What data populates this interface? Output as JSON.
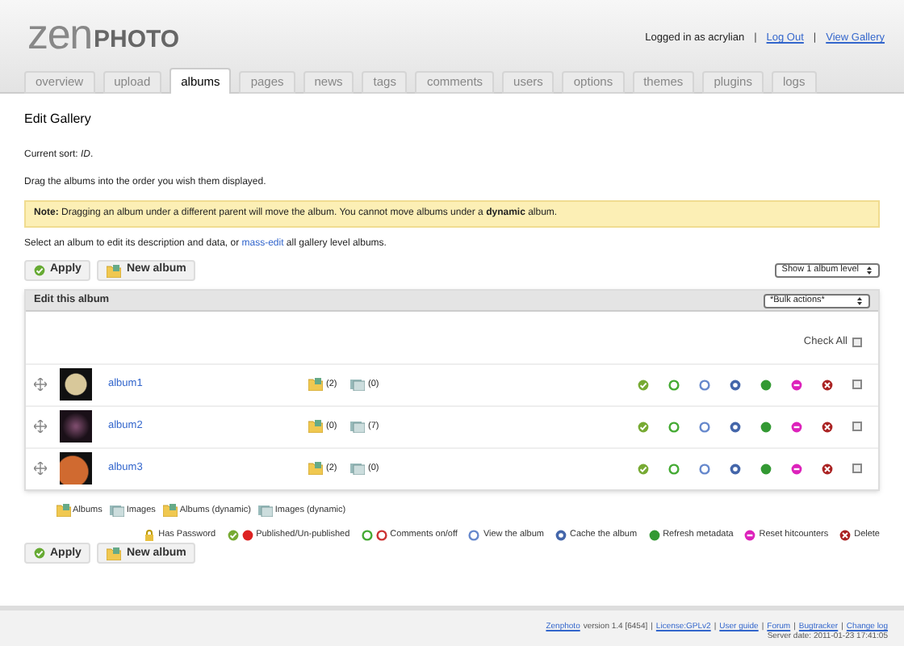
{
  "header": {
    "logo_main": "zen",
    "logo_sub": "PHOTO",
    "user_bar": [
      {
        "kind": "text",
        "text": "Logged in as acrylian"
      },
      {
        "kind": "separator",
        "text": "|"
      },
      {
        "kind": "link",
        "text": "Log Out"
      },
      {
        "kind": "separator",
        "text": "|"
      },
      {
        "kind": "link",
        "text": "View Gallery"
      }
    ]
  },
  "tabs": [
    {
      "label": "overview",
      "selected": false
    },
    {
      "label": "upload",
      "selected": false
    },
    {
      "label": "albums",
      "selected": true
    },
    {
      "label": "pages",
      "selected": false
    },
    {
      "label": "news",
      "selected": false
    },
    {
      "label": "tags",
      "selected": false
    },
    {
      "label": "comments",
      "selected": false
    },
    {
      "label": "users",
      "selected": false
    },
    {
      "label": "options",
      "selected": false
    },
    {
      "label": "themes",
      "selected": false
    },
    {
      "label": "plugins",
      "selected": false
    },
    {
      "label": "logs",
      "selected": false
    }
  ],
  "title": "Edit Gallery",
  "current_sort": "Current sort: *ID*.",
  "instructions": "Drag the albums into the order you wish them displayed.",
  "note": "**Note:** Dragging an album under a different parent will move the album. You cannot move albums under a **dynamic** album.",
  "select_text_before": "Select an album to edit its description and data, or",
  "mass_edit_link": "mass-edit",
  "select_text_after": "all gallery level albums.",
  "buttons": [
    "Apply",
    "New album"
  ],
  "level_select": "Show 1 album level",
  "panel": {
    "title": "Edit this album",
    "bulk_select": "*Bulk actions*",
    "check_all": "Check All",
    "check_all_checked": false
  },
  "albums": [
    {
      "name": "album1",
      "albums_count": "(2)",
      "images_count": "(0)",
      "checked": false
    },
    {
      "name": "album2",
      "albums_count": "(0)",
      "images_count": "(7)",
      "checked": false
    },
    {
      "name": "album3",
      "albums_count": "(2)",
      "images_count": "(0)",
      "checked": false
    }
  ],
  "type_legend": [
    "Albums",
    "Images",
    "Albums (dynamic)",
    "Images (dynamic)"
  ],
  "action_legend": [
    "Has Password",
    "Published/Un-published",
    "Comments on/off",
    "View the album",
    "Cache the album",
    "Refresh metadata",
    "Reset hitcounters",
    "Delete"
  ],
  "bottom_buttons": [
    "Apply",
    "New album"
  ],
  "footer": {
    "items": [
      {
        "kind": "link",
        "text": "Zenphoto"
      },
      {
        "kind": "text",
        "text": "version 1.4 [6454]"
      },
      {
        "kind": "separator",
        "text": "|"
      },
      {
        "kind": "link",
        "text": "License:GPLv2"
      },
      {
        "kind": "separator",
        "text": "|"
      },
      {
        "kind": "link",
        "text": "User guide"
      },
      {
        "kind": "separator",
        "text": "|"
      },
      {
        "kind": "link",
        "text": "Forum"
      },
      {
        "kind": "separator",
        "text": "|"
      },
      {
        "kind": "link",
        "text": "Bugtracker"
      },
      {
        "kind": "separator",
        "text": "|"
      },
      {
        "kind": "link",
        "text": "Change log"
      }
    ],
    "server_date": "Server date: 2011-01-23 17:41:05"
  }
}
